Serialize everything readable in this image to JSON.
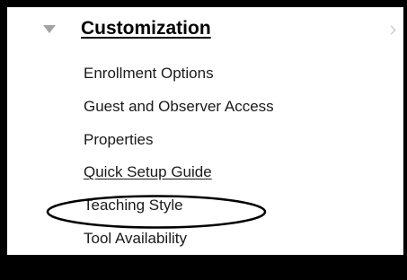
{
  "menu": {
    "title": "Customization",
    "expand_icon": "triangle-down-icon",
    "chevron_icon": "chevron-right-icon",
    "items": [
      {
        "label": "Enrollment Options"
      },
      {
        "label": "Guest and Observer Access"
      },
      {
        "label": "Properties"
      },
      {
        "label": "Quick Setup Guide"
      },
      {
        "label": "Teaching Style"
      },
      {
        "label": "Tool Availability"
      }
    ]
  },
  "colors": {
    "border": "#000000",
    "background": "#ffffff",
    "text": "#1a1a1a",
    "collapse_icon": "#a3a3a3"
  }
}
